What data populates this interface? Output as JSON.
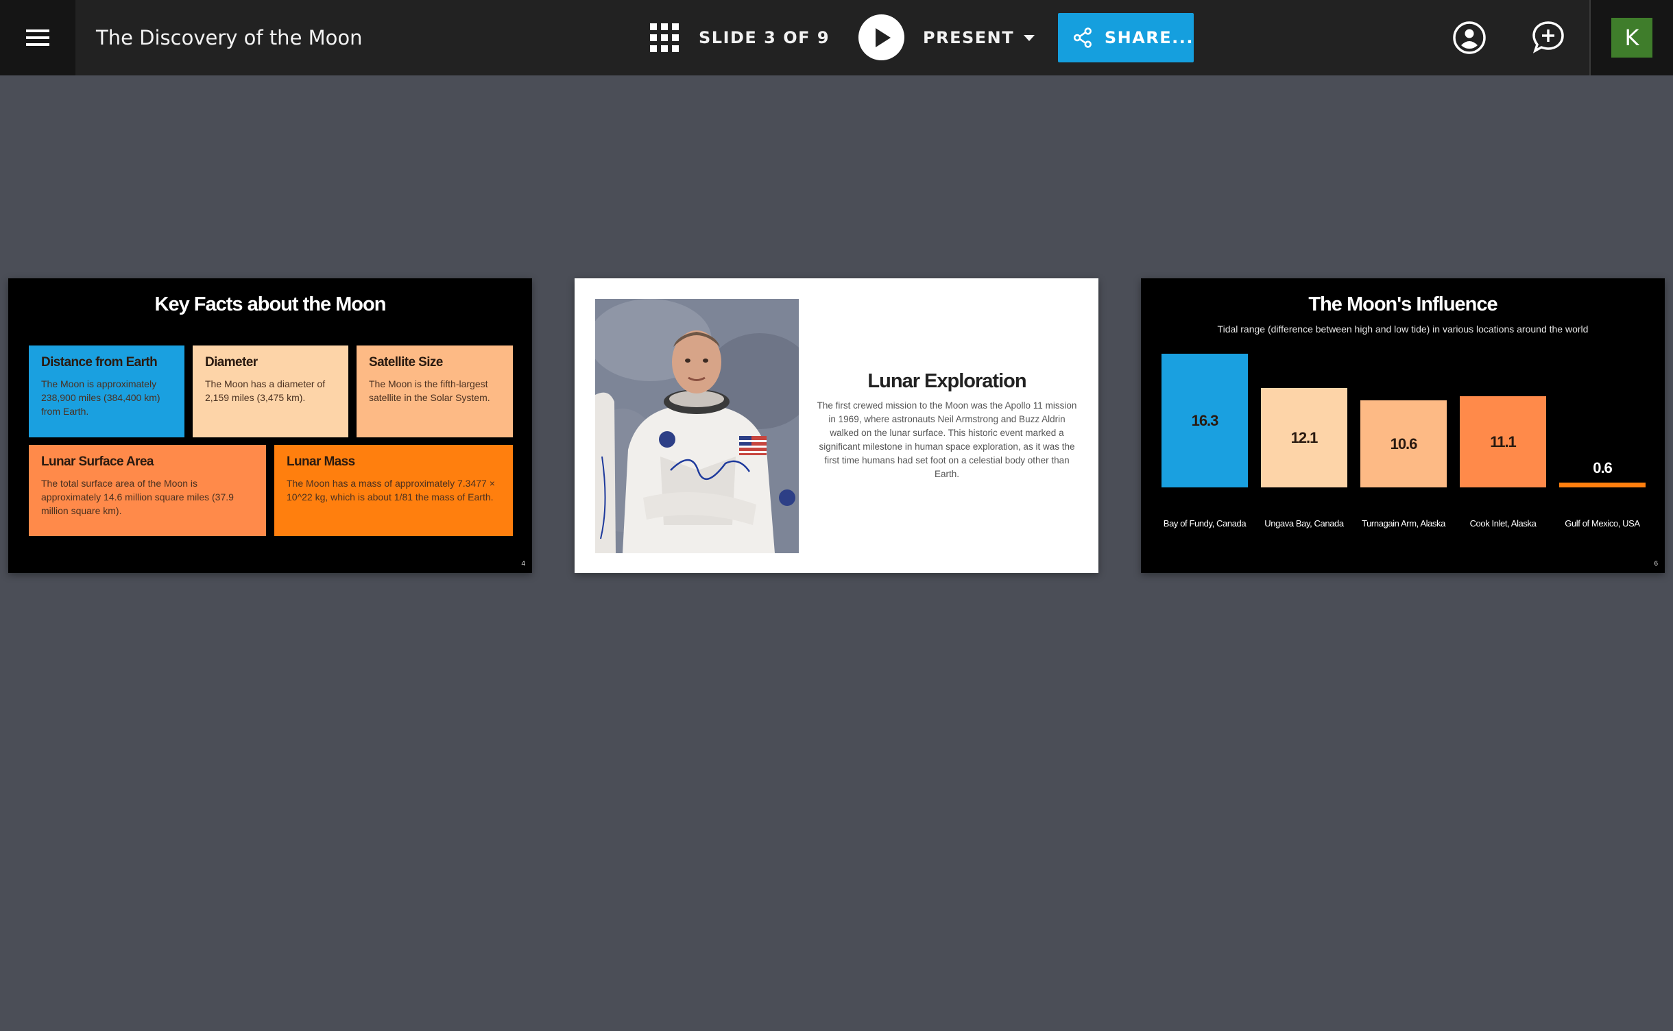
{
  "app": {
    "document_title": "The Discovery of the Moon",
    "slide_counter": "SLIDE 3 OF 9",
    "present_label": "PRESENT",
    "share_label": "SHARE...",
    "avatar_initial": "K",
    "icons": {
      "menu": "hamburger-icon",
      "grid": "grid-icon",
      "play": "play-icon",
      "share": "share-icon",
      "user": "user-circle-icon",
      "comment": "add-comment-icon"
    },
    "colors": {
      "topbar": "#222222",
      "canvas": "#4b4e57",
      "share": "#159fde",
      "avatar": "#3f7d2b"
    }
  },
  "slides": [
    {
      "title": "Key Facts about the Moon",
      "page_number": "4",
      "cards": [
        {
          "heading": "Distance from Earth",
          "body": "The Moon is approximately 238,900 miles (384,400 km) from Earth.",
          "color": "#1aa0e0"
        },
        {
          "heading": "Diameter",
          "body": "The Moon has a diameter of 2,159 miles (3,475 km).",
          "color": "#fdd4a8"
        },
        {
          "heading": "Satellite Size",
          "body": "The Moon is the fifth-largest satellite in the Solar System.",
          "color": "#fdba85"
        },
        {
          "heading": "Lunar Surface Area",
          "body": "The total surface area of the Moon is approximately 14.6 million square miles (37.9 million square km).",
          "color": "#ff8a4a"
        },
        {
          "heading": "Lunar Mass",
          "body": "The Moon has a mass of approximately 7.3477 × 10^22 kg, which is about 1/81 the mass of Earth.",
          "color": "#ff7f0e"
        }
      ]
    },
    {
      "title": "Lunar Exploration",
      "body": "The first crewed mission to the Moon was the Apollo 11 mission in 1969, where astronauts Neil Armstrong and Buzz Aldrin walked on the lunar surface. This historic event marked a significant milestone in human space exploration, as it was the first time humans had set foot on a celestial body other than Earth."
    },
    {
      "title": "The Moon's Influence",
      "subtitle": "Tidal range (difference between high and low tide) in various locations around the world",
      "page_number": "6"
    }
  ],
  "chart_data": {
    "type": "bar",
    "title": "The Moon's Influence",
    "subtitle": "Tidal range (difference between high and low tide) in various locations around the world",
    "categories": [
      "Bay of Fundy, Canada",
      "Ungava Bay, Canada",
      "Turnagain Arm, Alaska",
      "Cook Inlet, Alaska",
      "Gulf of Mexico, USA"
    ],
    "values": [
      16.3,
      12.1,
      10.6,
      11.1,
      0.6
    ],
    "value_labels": [
      "16.3",
      "12.1",
      "10.6",
      "11.1",
      "0.6"
    ],
    "colors": [
      "#1aa0e0",
      "#fdd4a8",
      "#fdba85",
      "#ff8a4a",
      "#ff7f0e"
    ],
    "ylim": [
      0,
      16.3
    ]
  }
}
